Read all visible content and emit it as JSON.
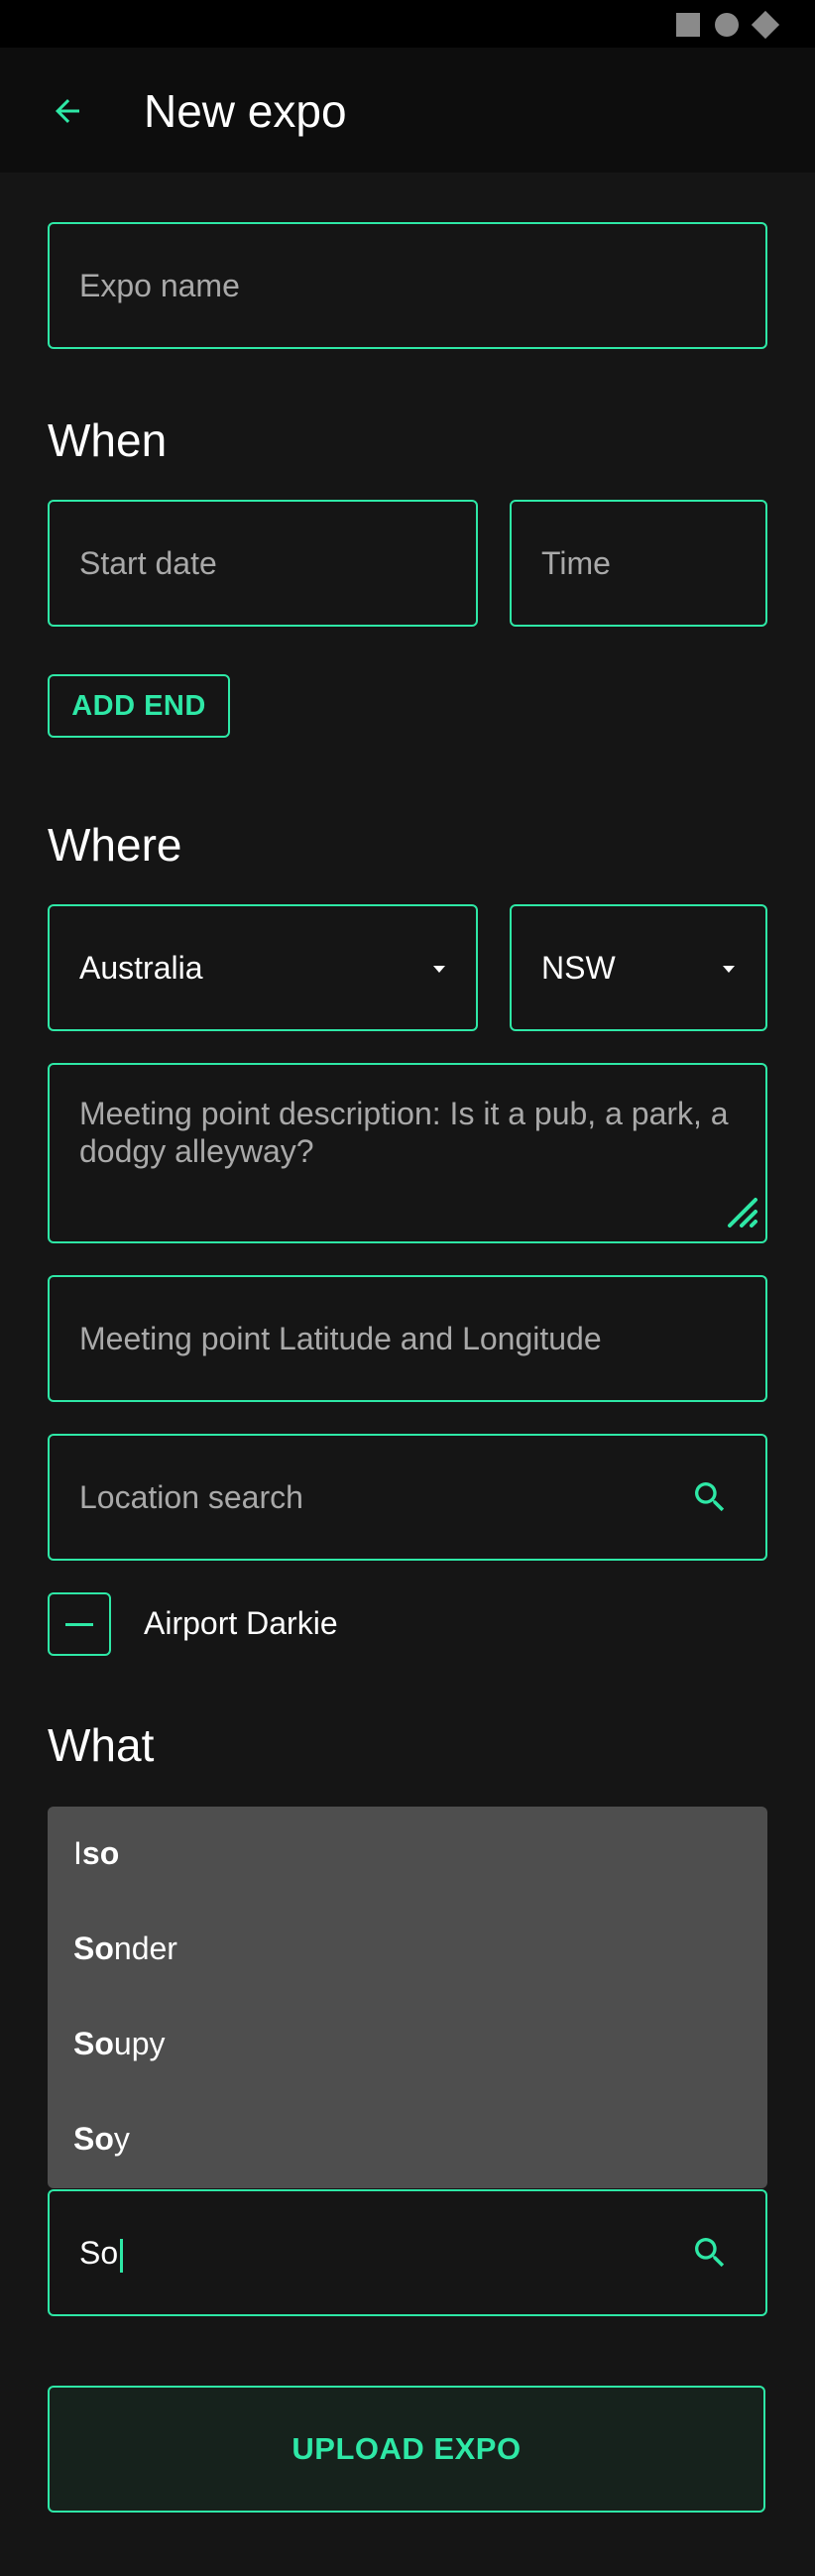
{
  "app_bar": {
    "title": "New expo"
  },
  "form": {
    "expo_name_placeholder": "Expo name",
    "when": {
      "heading": "When",
      "start_date_placeholder": "Start date",
      "time_placeholder": "Time",
      "add_end_label": "ADD END"
    },
    "where": {
      "heading": "Where",
      "country_value": "Australia",
      "state_value": "NSW",
      "meeting_description_placeholder_line1": "Meeting point description: Is it a pub, a park, a",
      "meeting_description_placeholder_line2": "dodgy alleyway?",
      "lat_long_placeholder": "Meeting point Latitude and Longitude",
      "location_search_placeholder": "Location search",
      "checkbox_label": "Airport Darkie"
    },
    "what": {
      "heading": "What",
      "search_value": "So",
      "suggestions": [
        {
          "bold": "",
          "pre": "I",
          "match": "so",
          "rest": ""
        },
        {
          "bold": "So",
          "rest": "nder"
        },
        {
          "bold": "So",
          "rest": "upy"
        },
        {
          "bold": "So",
          "rest": "y"
        }
      ]
    },
    "upload_label": "UPLOAD EXPO"
  },
  "colors": {
    "accent": "#2ee8a6",
    "background": "#151515",
    "app_bar": "#0d0d0d",
    "suggestions_bg": "#4e4e4e"
  },
  "icons": {
    "back": "arrow-left-icon",
    "search": "search-icon",
    "dropdown": "caret-down-icon",
    "resize": "resize-handle-icon"
  }
}
